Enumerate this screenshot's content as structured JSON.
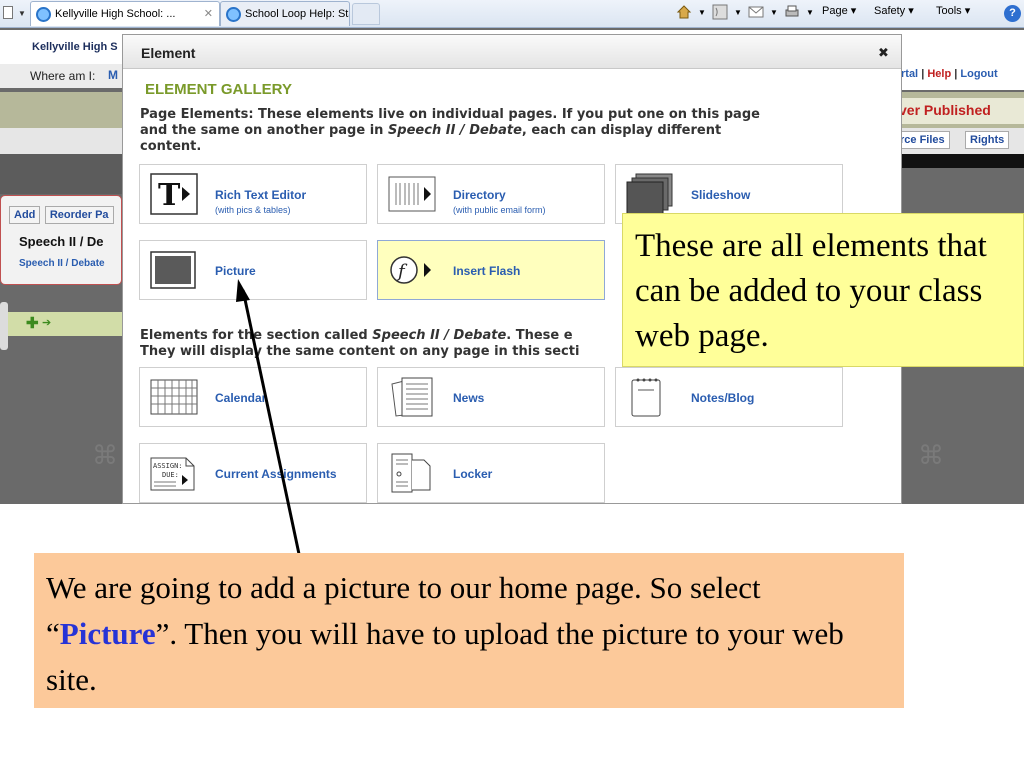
{
  "browser": {
    "tabs": [
      {
        "label": "Kellyville High School: ...",
        "close": "✕"
      },
      {
        "label": "School Loop Help: Standar..."
      }
    ],
    "commands": {
      "page": "Page ▾",
      "safety": "Safety ▾",
      "tools": "Tools ▾"
    }
  },
  "site": {
    "school_name": "Kellyville High S",
    "where_am_i_label": "Where am I:",
    "where_am_i_value": "M",
    "portal_link": "rtal",
    "help_link": "Help",
    "logout_link": "Logout",
    "separator": "|",
    "status": "ver Published",
    "resource_files_tab": "rce Files",
    "rights_tab": "Rights",
    "add_button": "Add",
    "reorder_button": "Reorder Pa",
    "section_title": "Speech II / De",
    "section_link": "Speech II / Debate"
  },
  "modal": {
    "title": "Element",
    "close_icon": "✖",
    "gallery_heading": "ELEMENT GALLERY",
    "page_elements_text_1": "Page Elements: These elements live on individual pages. If you put one on this page",
    "page_elements_text_2a": "and the same on another page in ",
    "page_elements_text_2_italic": "Speech II / Debate",
    "page_elements_text_2b": ", each can display different",
    "page_elements_text_3": "content.",
    "page_elements": [
      {
        "label": "Rich Text Editor",
        "sub": "(with pics & tables)",
        "icon": "rich-text-icon"
      },
      {
        "label": "Directory",
        "sub": "(with public email form)",
        "icon": "directory-icon"
      },
      {
        "label": "Slideshow",
        "icon": "slideshow-icon"
      },
      {
        "label": "Picture",
        "icon": "picture-icon"
      },
      {
        "label": "Insert Flash",
        "icon": "flash-icon"
      }
    ],
    "section_elements_text_1a": "Elements for the section called ",
    "section_elements_text_1_italic": "Speech II / Debate",
    "section_elements_text_1b": ". These e",
    "section_elements_text_2": "They will display the same content on any page in this secti",
    "section_elements": [
      {
        "label": "Calendar",
        "icon": "calendar-icon"
      },
      {
        "label": "News",
        "icon": "news-icon"
      },
      {
        "label": "Notes/Blog",
        "icon": "notes-blog-icon"
      },
      {
        "label": "Current Assignments",
        "icon": "assignments-icon"
      },
      {
        "label": "Locker",
        "icon": "locker-icon"
      }
    ],
    "assign_icon_text": "ASSIGN:",
    "due_icon_text": "DUE:"
  },
  "annotations": {
    "callout_top": "These are all elements that can be added to your class web page.",
    "callout_bottom_before": "We are going to add a picture to our home page.  So select “",
    "callout_bottom_highlight": "Picture",
    "callout_bottom_after": "”.  Then you will have to upload the picture to your web site."
  },
  "colors": {
    "gallery_heading": "#7a9a2a",
    "link_blue": "#2a5db0",
    "highlight_card": "#ffffbe",
    "callout_top_bg": "#ffff99",
    "callout_bottom_bg": "#fcc99a",
    "picture_word": "#2633d6"
  }
}
